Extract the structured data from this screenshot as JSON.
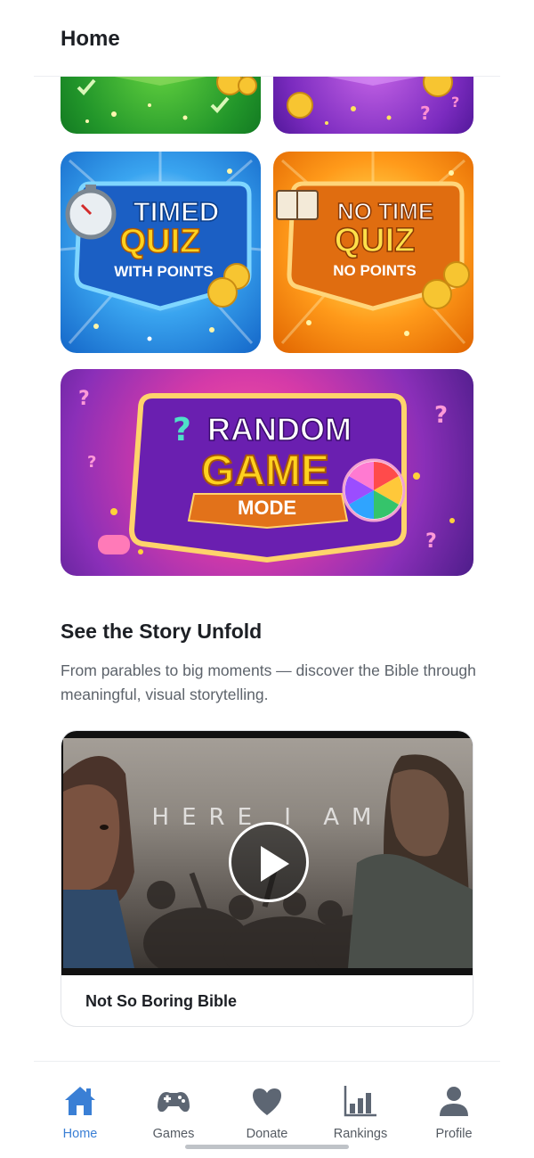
{
  "header": {
    "title": "Home"
  },
  "game_modes": {
    "timed": {
      "line1": "TIMED",
      "line2": "QUIZ",
      "line3": "WITH POINTS"
    },
    "notime": {
      "line1": "NO TIME",
      "line2": "QUIZ",
      "line3": "NO POINTS"
    },
    "random": {
      "line1": "RANDOM",
      "line2": "GAME",
      "line3": "MODE"
    }
  },
  "story": {
    "title": "See the Story Unfold",
    "description": "From parables to big moments — discover the Bible through meaningful, visual storytelling.",
    "video": {
      "overlay_text": "HERE I AM",
      "caption": "Not So Boring Bible"
    }
  },
  "bottom_nav": {
    "items": [
      {
        "label": "Home",
        "icon": "home-icon",
        "active": true
      },
      {
        "label": "Games",
        "icon": "gamepad-icon",
        "active": false
      },
      {
        "label": "Donate",
        "icon": "heart-icon",
        "active": false
      },
      {
        "label": "Rankings",
        "icon": "bar-chart-icon",
        "active": false
      },
      {
        "label": "Profile",
        "icon": "user-icon",
        "active": false
      }
    ]
  },
  "colors": {
    "accent": "#3a7fd5",
    "nav_icon": "#5d6673",
    "text_primary": "#1c1f24",
    "text_secondary": "#5d636b"
  }
}
